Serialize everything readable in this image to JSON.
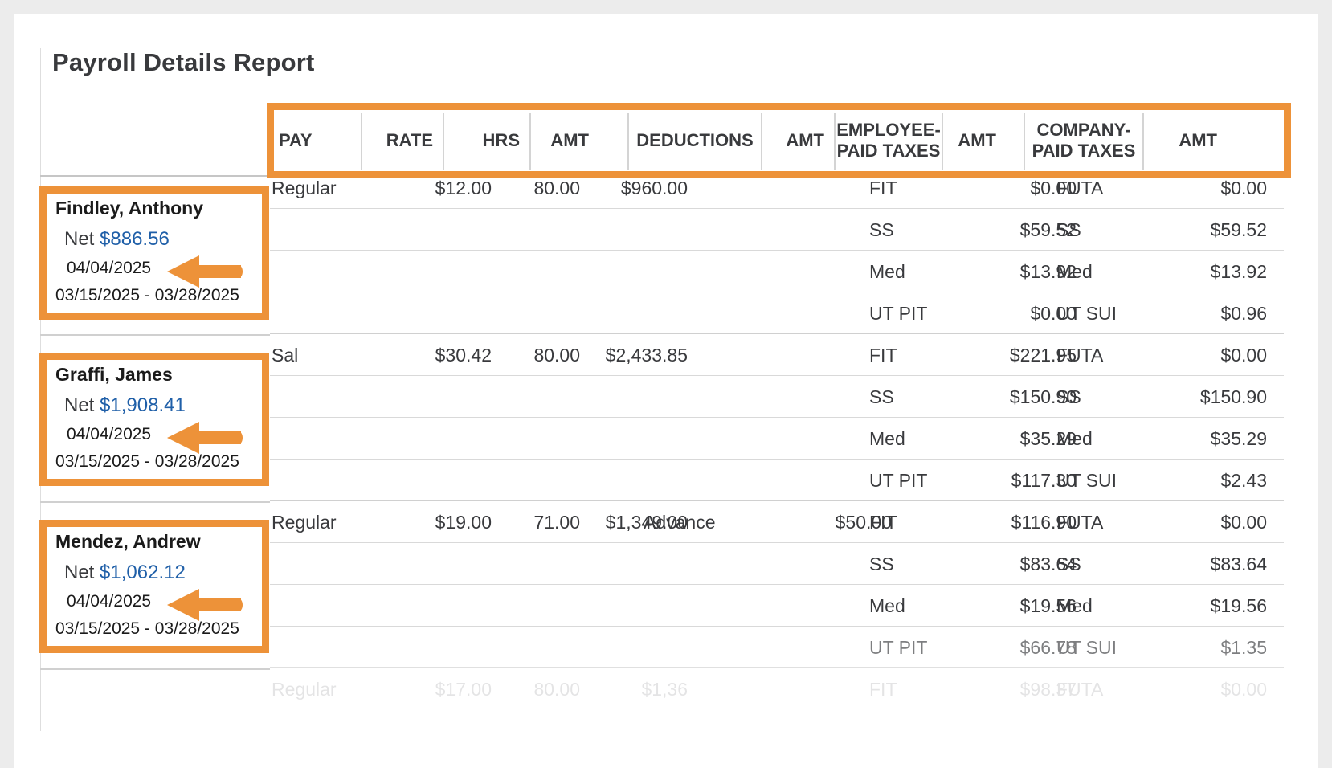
{
  "report": {
    "title": "Payroll Details Report"
  },
  "columns": [
    {
      "key": "pay",
      "label": "PAY"
    },
    {
      "key": "rate",
      "label": "RATE"
    },
    {
      "key": "hrs",
      "label": "HRS"
    },
    {
      "key": "amt",
      "label": "AMT"
    },
    {
      "key": "deductions",
      "label": "DEDUCTIONS"
    },
    {
      "key": "ded_amt",
      "label": "AMT"
    },
    {
      "key": "emp_tax",
      "label": "EMPLOYEE-\nPAID TAXES"
    },
    {
      "key": "emp_tax_amt",
      "label": "AMT"
    },
    {
      "key": "co_tax",
      "label": "COMPANY-\nPAID TAXES"
    },
    {
      "key": "co_tax_amt",
      "label": "AMT"
    }
  ],
  "employees": [
    {
      "name": "Findley, Anthony",
      "net_label": "Net",
      "net": "$886.56",
      "pay_date": "04/04/2025",
      "period": "03/15/2025 - 03/28/2025",
      "rows": [
        {
          "pay": "Regular",
          "rate": "$12.00",
          "hrs": "80.00",
          "amt": "$960.00",
          "deductions": "",
          "ded_amt": "",
          "emp_tax": "FIT",
          "emp_tax_amt": "$0.00",
          "co_tax": "FUTA",
          "co_tax_amt": "$0.00"
        },
        {
          "pay": "",
          "rate": "",
          "hrs": "",
          "amt": "",
          "deductions": "",
          "ded_amt": "",
          "emp_tax": "SS",
          "emp_tax_amt": "$59.52",
          "co_tax": "SS",
          "co_tax_amt": "$59.52"
        },
        {
          "pay": "",
          "rate": "",
          "hrs": "",
          "amt": "",
          "deductions": "",
          "ded_amt": "",
          "emp_tax": "Med",
          "emp_tax_amt": "$13.92",
          "co_tax": "Med",
          "co_tax_amt": "$13.92"
        },
        {
          "pay": "",
          "rate": "",
          "hrs": "",
          "amt": "",
          "deductions": "",
          "ded_amt": "",
          "emp_tax": "UT PIT",
          "emp_tax_amt": "$0.00",
          "co_tax": "UT SUI",
          "co_tax_amt": "$0.96"
        }
      ]
    },
    {
      "name": "Graffi, James",
      "net_label": "Net",
      "net": "$1,908.41",
      "pay_date": "04/04/2025",
      "period": "03/15/2025 - 03/28/2025",
      "rows": [
        {
          "pay": "Sal",
          "rate": "$30.42",
          "hrs": "80.00",
          "amt": "$2,433.85",
          "deductions": "",
          "ded_amt": "",
          "emp_tax": "FIT",
          "emp_tax_amt": "$221.95",
          "co_tax": "FUTA",
          "co_tax_amt": "$0.00"
        },
        {
          "pay": "",
          "rate": "",
          "hrs": "",
          "amt": "",
          "deductions": "",
          "ded_amt": "",
          "emp_tax": "SS",
          "emp_tax_amt": "$150.90",
          "co_tax": "SS",
          "co_tax_amt": "$150.90"
        },
        {
          "pay": "",
          "rate": "",
          "hrs": "",
          "amt": "",
          "deductions": "",
          "ded_amt": "",
          "emp_tax": "Med",
          "emp_tax_amt": "$35.29",
          "co_tax": "Med",
          "co_tax_amt": "$35.29"
        },
        {
          "pay": "",
          "rate": "",
          "hrs": "",
          "amt": "",
          "deductions": "",
          "ded_amt": "",
          "emp_tax": "UT PIT",
          "emp_tax_amt": "$117.30",
          "co_tax": "UT SUI",
          "co_tax_amt": "$2.43"
        }
      ]
    },
    {
      "name": "Mendez, Andrew",
      "net_label": "Net",
      "net": "$1,062.12",
      "pay_date": "04/04/2025",
      "period": "03/15/2025 - 03/28/2025",
      "rows": [
        {
          "pay": "Regular",
          "rate": "$19.00",
          "hrs": "71.00",
          "amt": "$1,349.00",
          "deductions": "Advance",
          "ded_amt": "$50.00",
          "emp_tax": "FIT",
          "emp_tax_amt": "$116.90",
          "co_tax": "FUTA",
          "co_tax_amt": "$0.00"
        },
        {
          "pay": "",
          "rate": "",
          "hrs": "",
          "amt": "",
          "deductions": "",
          "ded_amt": "",
          "emp_tax": "SS",
          "emp_tax_amt": "$83.64",
          "co_tax": "SS",
          "co_tax_amt": "$83.64"
        },
        {
          "pay": "",
          "rate": "",
          "hrs": "",
          "amt": "",
          "deductions": "",
          "ded_amt": "",
          "emp_tax": "Med",
          "emp_tax_amt": "$19.56",
          "co_tax": "Med",
          "co_tax_amt": "$19.56"
        },
        {
          "pay": "",
          "rate": "",
          "hrs": "",
          "amt": "",
          "deductions": "",
          "ded_amt": "",
          "emp_tax": "UT PIT",
          "emp_tax_amt": "$66.78",
          "co_tax": "UT SUI",
          "co_tax_amt": "$1.35"
        }
      ]
    }
  ],
  "partial_row": {
    "pay": "Regular",
    "rate": "$17.00",
    "hrs": "80.00",
    "amt": "$1,36",
    "deductions": "",
    "ded_amt": "",
    "emp_tax": "FIT",
    "emp_tax_amt": "$98.37",
    "co_tax": "FUTA",
    "co_tax_amt": "$0.00"
  },
  "colors": {
    "highlight": "#ed9239",
    "net_link": "#1f5fa8",
    "text": "#393a3d"
  }
}
